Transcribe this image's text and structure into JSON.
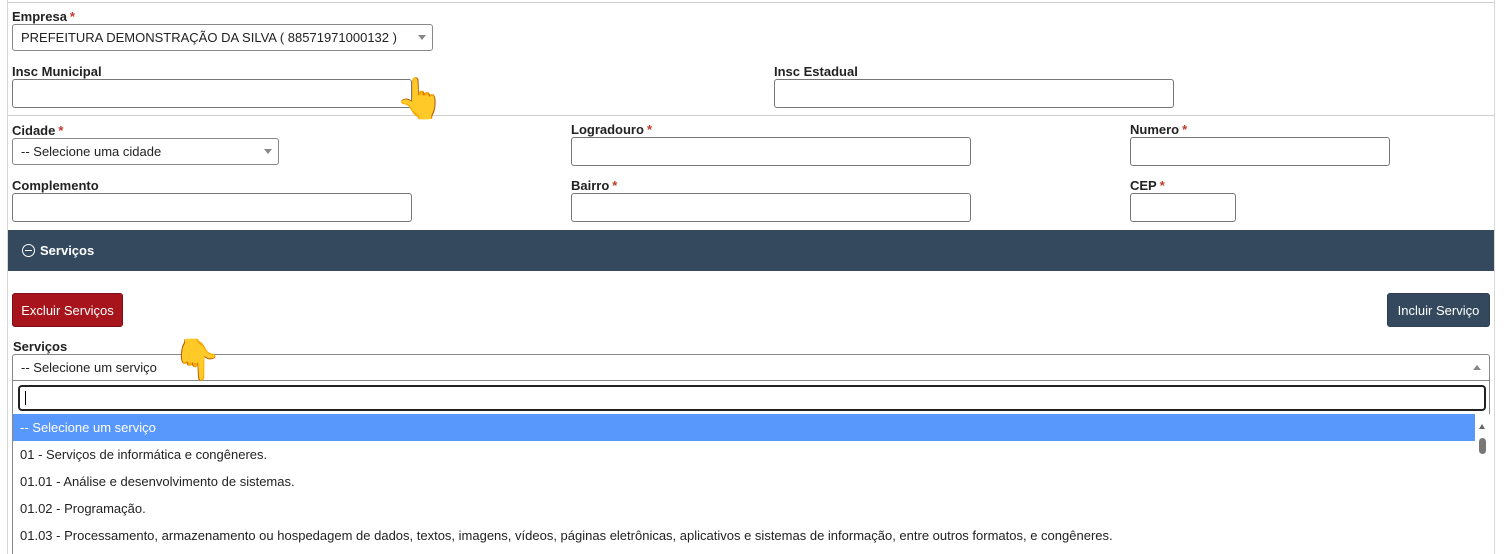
{
  "empresa": {
    "label": "Empresa",
    "required_mark": "*",
    "value": "PREFEITURA DEMONSTRAÇÃO DA SILVA ( 88571971000132 )"
  },
  "insc_municipal": {
    "label": "Insc Municipal",
    "value": ""
  },
  "insc_estadual": {
    "label": "Insc Estadual",
    "value": ""
  },
  "cidade": {
    "label": "Cidade",
    "required_mark": "*",
    "value": "-- Selecione uma cidade"
  },
  "logradouro": {
    "label": "Logradouro",
    "required_mark": "*",
    "value": ""
  },
  "numero": {
    "label": "Numero",
    "required_mark": "*",
    "value": ""
  },
  "complemento": {
    "label": "Complemento",
    "value": ""
  },
  "bairro": {
    "label": "Bairro",
    "required_mark": "*",
    "value": ""
  },
  "cep": {
    "label": "CEP",
    "required_mark": "*",
    "value": ""
  },
  "servicos_panel": {
    "title": "Serviços",
    "collapse_icon": "minus-circle-icon",
    "header_color": "#34495e",
    "excluir_label": "Excluir Serviços",
    "excluir_color": "#a8141b",
    "incluir_label": "Incluir Serviço",
    "incluir_color": "#34495e",
    "field_label": "Serviços",
    "select_value": "-- Selecione um serviço",
    "dropdown": {
      "search_value": "",
      "options": [
        "-- Selecione um serviço",
        "01 - Serviços de informática e congêneres.",
        "01.01 - Análise e desenvolvimento de sistemas.",
        "01.02 - Programação.",
        "01.03 - Processamento, armazenamento ou hospedagem de dados, textos, imagens, vídeos, páginas eletrônicas, aplicativos e sistemas de informação, entre outros formatos, e congêneres."
      ],
      "highlight_color": "#5897fb"
    }
  },
  "cursor_hands": [
    "pointing-hand-icon",
    "pointing-hand-icon"
  ]
}
